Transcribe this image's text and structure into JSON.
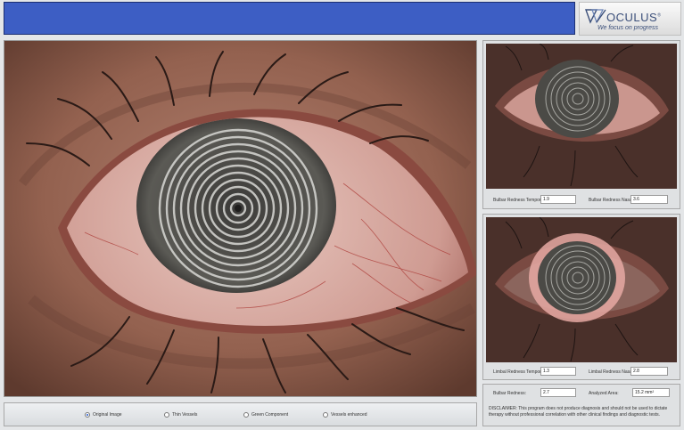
{
  "logo": {
    "brand": "OCULUS",
    "registered": "®",
    "tagline": "We focus on progress",
    "icon": "oculus-logo-icon"
  },
  "main_image": {
    "description_icon": "eye-image-original"
  },
  "panel_top": {
    "fields": [
      {
        "label": "Bulbar Redness Temporal:",
        "value": "1.9"
      },
      {
        "label": "Bulbar Redness Nasal:",
        "value": "3.6"
      }
    ]
  },
  "panel_mid": {
    "fields": [
      {
        "label": "Limbal Redness Temporal:",
        "value": "1.3"
      },
      {
        "label": "Limbal Redness Nasal:",
        "value": "2.8"
      }
    ]
  },
  "summary": {
    "fields": [
      {
        "label": "Bulbar Redness:",
        "value": "2.7"
      },
      {
        "label": "Analyzed Area:",
        "value": "15.2 mm²"
      }
    ],
    "disclaimer": "DISCLAIMER: This program does not produce diagnosis and should not be used to dictate therapy without professional correlation with other clinical findings and diagnostic tests."
  },
  "view_options": {
    "selected": "Original Image",
    "items": [
      {
        "label": "Original Image",
        "selected": true
      },
      {
        "label": "Thin Vessels",
        "selected": false
      },
      {
        "label": "Green Component",
        "selected": false
      },
      {
        "label": "Vessels enhanced",
        "selected": false
      }
    ]
  },
  "colors": {
    "header": "#3d5ec4",
    "brand": "#3b4f7a",
    "radio_selected": "#1f55c9"
  }
}
